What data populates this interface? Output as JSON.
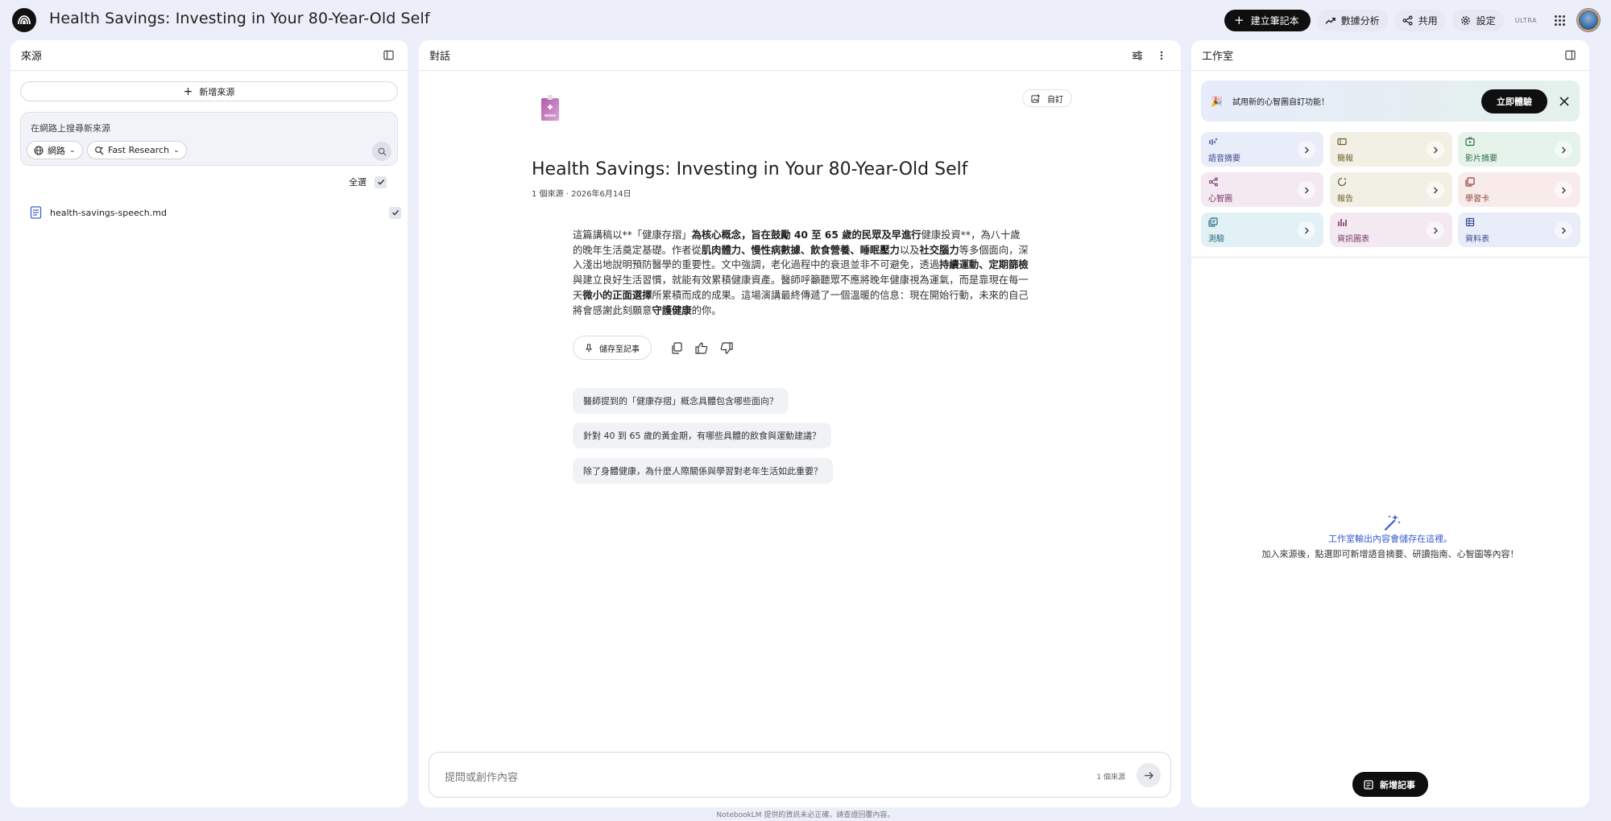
{
  "app": {
    "notebook_title": "Health Savings: Investing in Your 80-Year-Old Self",
    "create_button": "建立筆記本",
    "analytics_button": "數據分析",
    "share_button": "共用",
    "settings_button": "設定",
    "tier_badge": "ULTRA"
  },
  "sources": {
    "header": "來源",
    "add_button": "新增來源",
    "search_placeholder": "在網路上搜尋新來源",
    "web_chip": "網路",
    "research_chip": "Fast Research",
    "select_all": "全選",
    "items": [
      {
        "name": "health-savings-speech.md"
      }
    ]
  },
  "chat": {
    "header": "對話",
    "customize_button": "自訂",
    "title": "Health Savings: Investing in Your 80-Year-Old Self",
    "meta": "1 個來源 · 2026年6月14日",
    "summary_parts": [
      {
        "t": "這篇講稿以**「健康存摺」",
        "b": false
      },
      {
        "t": "為核心概念，旨在鼓勵 40 至 65 歲的民眾及早進行",
        "b": true
      },
      {
        "t": "健康投資**，為八十歲的晚年生活奠定基礎。作者從",
        "b": false
      },
      {
        "t": "肌肉體力、慢性病數據、飲食營養、睡眠壓力",
        "b": true
      },
      {
        "t": "以及",
        "b": false
      },
      {
        "t": "社交腦力",
        "b": true
      },
      {
        "t": "等多個面向，深入淺出地說明預防醫學的重要性。文中強調，老化過程中的衰退並非不可避免，透過",
        "b": false
      },
      {
        "t": "持續運動、定期篩檢",
        "b": true
      },
      {
        "t": "與建立良好生活習慣，就能有效累積健康資產。醫師呼籲聽眾不應將晚年健康視為運氣，而是靠現在每一天",
        "b": false
      },
      {
        "t": "微小的正面選擇",
        "b": true
      },
      {
        "t": "所累積而成的成果。這場演講最終傳遞了一個溫暖的信息：現在開始行動，未來的自己將會感謝此刻願意",
        "b": false
      },
      {
        "t": "守護健康",
        "b": true
      },
      {
        "t": "的你。",
        "b": false
      }
    ],
    "save_note_button": "儲存至記事",
    "suggestions": [
      "醫師提到的「健康存摺」概念具體包含哪些面向？",
      "針對 40 到 65 歲的黃金期，有哪些具體的飲食與運動建議？",
      "除了身體健康，為什麼人際關係與學習對老年生活如此重要？"
    ],
    "composer_placeholder": "提問或創作內容",
    "source_count": "1 個來源"
  },
  "studio": {
    "header": "工作室",
    "banner_text": "試用新的心智圖自訂功能！",
    "banner_button": "立即體驗",
    "tiles": [
      {
        "label": "語音摘要",
        "bg": "#e9ecf9",
        "color": "#3b4a8f",
        "icon": "audio-overview-icon"
      },
      {
        "label": "簡報",
        "bg": "#f2f0e4",
        "color": "#6b5d2b",
        "icon": "slides-icon"
      },
      {
        "label": "影片摘要",
        "bg": "#e5f3ea",
        "color": "#2f6b45",
        "icon": "video-overview-icon"
      },
      {
        "label": "心智圖",
        "bg": "#f4e9f1",
        "color": "#7a3a6b",
        "icon": "mind-map-icon"
      },
      {
        "label": "報告",
        "bg": "#f2f0e4",
        "color": "#6b5d2b",
        "icon": "report-icon"
      },
      {
        "label": "學習卡",
        "bg": "#f9ebea",
        "color": "#8a3e36",
        "icon": "flashcards-icon"
      },
      {
        "label": "測驗",
        "bg": "#e2f1f5",
        "color": "#2b6a7e",
        "icon": "quiz-icon"
      },
      {
        "label": "資訊圖表",
        "bg": "#f4e9f1",
        "color": "#7a3a6b",
        "icon": "infographic-icon"
      },
      {
        "label": "資料表",
        "bg": "#e9ecf9",
        "color": "#3b4a8f",
        "icon": "data-table-icon"
      }
    ],
    "empty_title": "工作室輸出內容會儲存在這裡。",
    "empty_desc": "加入來源後，點選即可新增語音摘要、研讀指南、心智圖等內容！",
    "add_note_button": "新增記事"
  },
  "footer": {
    "disclaimer": "NotebookLM 提供的資訊未必正確，請查證回覆內容。"
  }
}
